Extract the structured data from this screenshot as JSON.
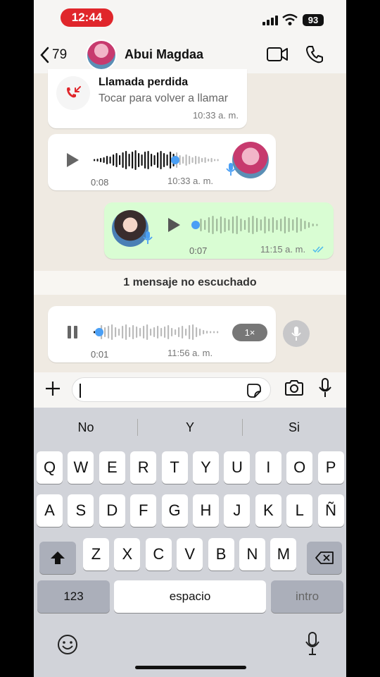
{
  "status_bar": {
    "time": "12:44",
    "battery": "93"
  },
  "header": {
    "back_count": "79",
    "contact_name": "Abui Magdaa"
  },
  "messages": {
    "missed_call": {
      "title": "Llamada perdida",
      "subtitle": "Tocar para volver a llamar",
      "time": "10:33 a. m."
    },
    "voice1": {
      "duration": "0:08",
      "time": "10:33 a. m.",
      "progress": 0.65
    },
    "voice2": {
      "duration": "0:07",
      "time": "11:15 a. m.",
      "progress": 0.0
    },
    "unread_banner": "1 mensaje no escuchado",
    "voice3": {
      "duration": "0:01",
      "time": "11:56 a. m.",
      "speed": "1×",
      "progress": 0.05
    }
  },
  "composer": {
    "value": ""
  },
  "keyboard": {
    "suggestions": [
      "No",
      "Y",
      "Si"
    ],
    "row1": [
      "Q",
      "W",
      "E",
      "R",
      "T",
      "Y",
      "U",
      "I",
      "O",
      "P"
    ],
    "row2": [
      "A",
      "S",
      "D",
      "F",
      "G",
      "H",
      "J",
      "K",
      "L",
      "Ñ"
    ],
    "row3": [
      "Z",
      "X",
      "C",
      "V",
      "B",
      "N",
      "M"
    ],
    "numbers_key": "123",
    "space_key": "espacio",
    "return_key": "intro"
  },
  "colors": {
    "time_pill": "#e0262b",
    "outgoing_bubble": "#d9fdd3",
    "waveform_accent": "#4a9ff5",
    "read_ticks": "#53bdeb"
  }
}
